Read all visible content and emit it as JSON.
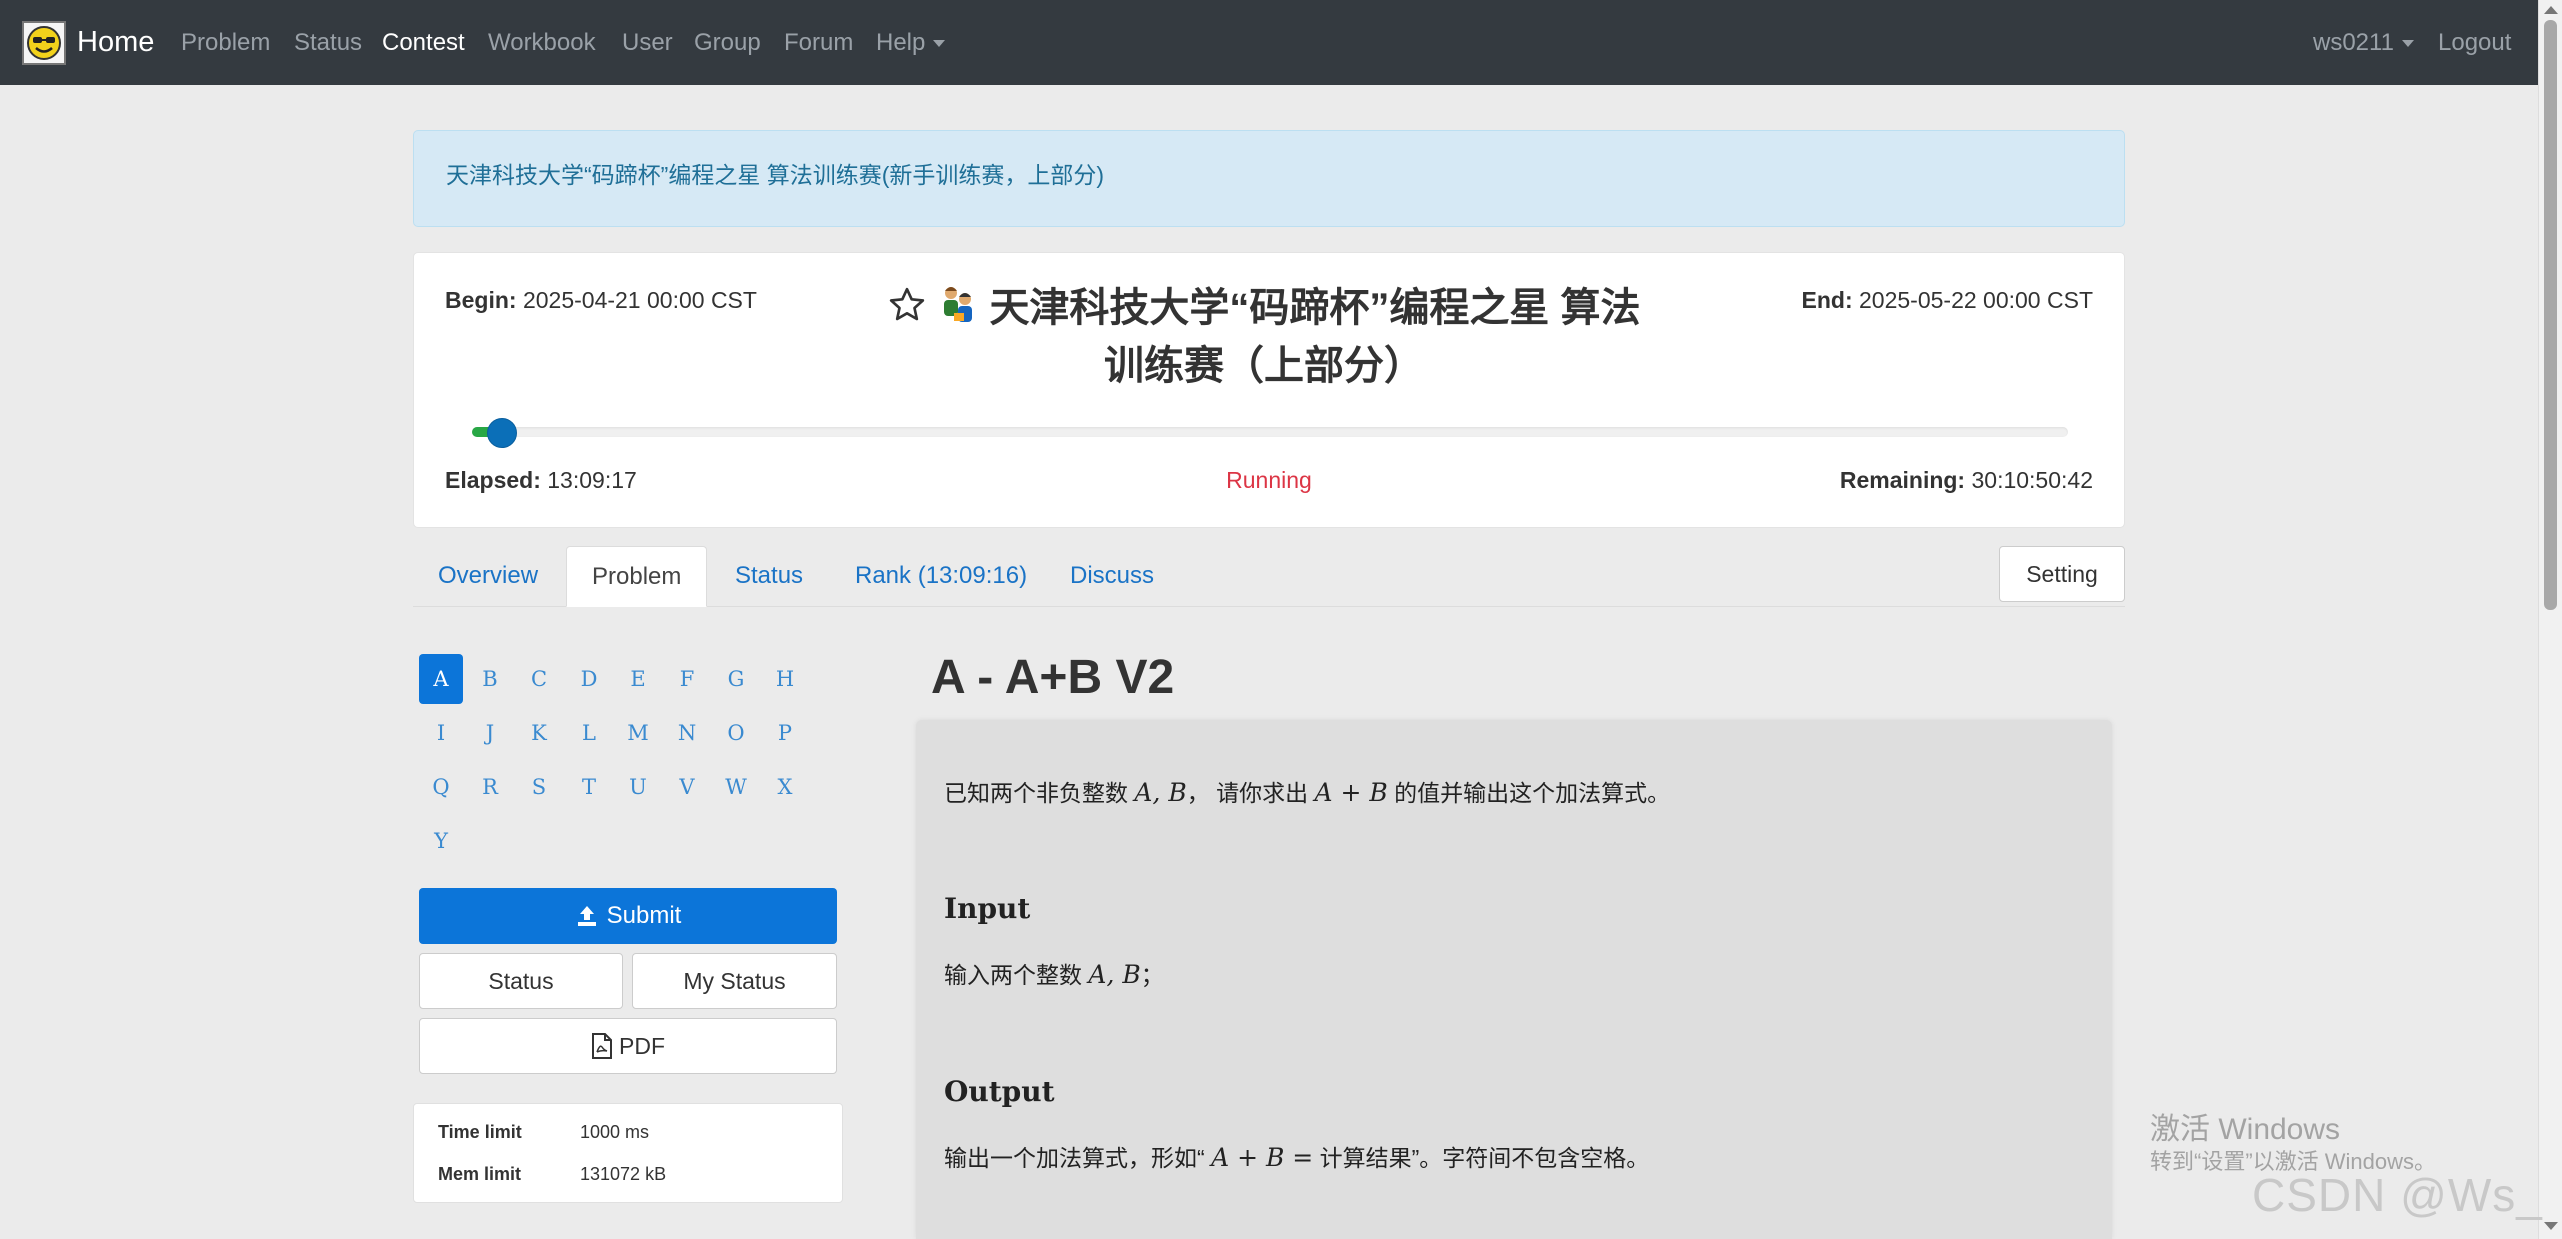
{
  "navbar": {
    "home": "Home",
    "links": [
      "Problem",
      "Status",
      "Contest",
      "Workbook",
      "User",
      "Group",
      "Forum",
      "Help"
    ],
    "user": "ws0211",
    "logout": "Logout"
  },
  "alert": {
    "text": "天津科技大学“码蹄杯”编程之星 算法训练赛(新手训练赛，上部分)"
  },
  "contest": {
    "begin_label": "Begin:",
    "begin_value": "2025-04-21 00:00 CST",
    "end_label": "End:",
    "end_value": "2025-05-22 00:00 CST",
    "title_line1": "天津科技大学“码蹄杯”编程之星 算法",
    "title_line2": "训练赛（上部分）",
    "elapsed_label": "Elapsed:",
    "elapsed_value": "13:09:17",
    "status": "Running",
    "remaining_label": "Remaining:",
    "remaining_value": "30:10:50:42",
    "progress_fraction": 0.018
  },
  "tabs": [
    "Overview",
    "Problem",
    "Status",
    "Rank (13:09:16)",
    "Discuss"
  ],
  "setting_label": "Setting",
  "letters": [
    "A",
    "B",
    "C",
    "D",
    "E",
    "F",
    "G",
    "H",
    "I",
    "J",
    "K",
    "L",
    "M",
    "N",
    "O",
    "P",
    "Q",
    "R",
    "S",
    "T",
    "U",
    "V",
    "W",
    "X",
    "Y"
  ],
  "buttons": {
    "submit": "Submit",
    "status": "Status",
    "my_status": "My Status",
    "pdf": "PDF"
  },
  "limits": {
    "time_label": "Time limit",
    "time_value": "1000 ms",
    "mem_label": "Mem limit",
    "mem_value": "131072 kB"
  },
  "problem": {
    "title": "A - A+B V2",
    "desc_pre": "已知两个非负整数",
    "desc_vars": "A, B",
    "desc_mid": "，  请你求出",
    "desc_expr": "A + B",
    "desc_post": "的值并输出这个加法算式。",
    "input_head": "Input",
    "input_pre": "输入两个整数",
    "input_vars": "A, B",
    "input_post": "；",
    "output_head": "Output",
    "output_pre": "输出一个加法算式，形如“",
    "output_expr": "A + B =",
    "output_post": "计算结果”。字符间不包含空格。"
  },
  "watermark": {
    "line1": "激活 Windows",
    "line2": "转到“设置”以激活 Windows。",
    "csdn": "CSDN @Ws_"
  }
}
